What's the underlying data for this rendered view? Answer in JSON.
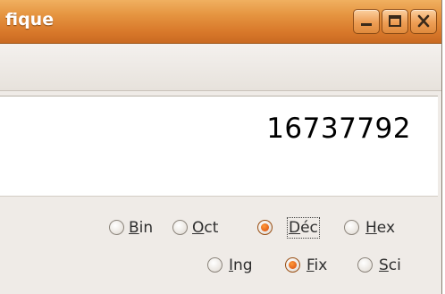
{
  "window": {
    "title": "fique",
    "controls": {
      "minimize": "minimize-icon",
      "maximize": "maximize-icon",
      "close": "close-icon"
    }
  },
  "display": {
    "value": "16737792"
  },
  "base_options": [
    {
      "key": "B",
      "rest": "in",
      "checked": false
    },
    {
      "key": "O",
      "rest": "ct",
      "checked": false
    },
    {
      "key": "D",
      "rest": "éc",
      "checked": true
    },
    {
      "key": "H",
      "rest": "ex",
      "checked": false
    }
  ],
  "format_options": [
    {
      "key": "I",
      "rest": "ng",
      "checked": false
    },
    {
      "key": "F",
      "rest": "ix",
      "checked": true
    },
    {
      "key": "S",
      "rest": "ci",
      "checked": false
    }
  ],
  "colors": {
    "titlebar": "#e08a3c",
    "radio_checked": "#e3621b",
    "panel": "#efebe7"
  }
}
